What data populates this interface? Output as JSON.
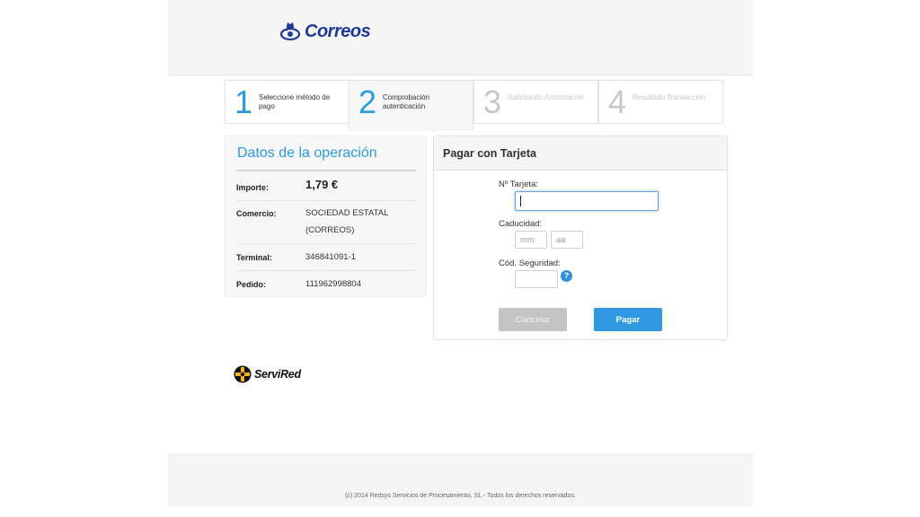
{
  "brand": {
    "name": "Correos",
    "color": "#1f3a93",
    "icon": "crown-horn-icon"
  },
  "steps": [
    {
      "number": "1",
      "label": "Seleccione método de pago",
      "state": "done"
    },
    {
      "number": "2",
      "label": "Comprobación autenticación",
      "state": "active"
    },
    {
      "number": "3",
      "label": "Solicitando Autorización",
      "state": "pending"
    },
    {
      "number": "4",
      "label": "Resultado Transacción",
      "state": "pending"
    }
  ],
  "operation": {
    "title": "Datos de la operación",
    "rows": [
      {
        "key": "Importe:",
        "value": "1,79 €"
      },
      {
        "key": "Comercio:",
        "value": "SOCIEDAD ESTATAL (CORREOS)"
      },
      {
        "key": "Terminal:",
        "value": "346841091-1"
      },
      {
        "key": "Pedido:",
        "value": "111962998804"
      }
    ]
  },
  "payment": {
    "title": "Pagar con Tarjeta",
    "card_label": "Nº Tarjeta:",
    "card_value": "",
    "expiry_label": "Caducidad:",
    "month_placeholder": "mm",
    "year_placeholder": "aa",
    "cvv_label": "Cód. Seguridad:",
    "cvv_value": "",
    "help_glyph": "?",
    "cancel_label": "Cancelar",
    "submit_label": "Pagar"
  },
  "network": {
    "name": "ServiRed",
    "icon": "servired-logo-icon"
  },
  "footer": {
    "text": "(c) 2014 Redsys Servicios de Procesamiento, SL - Todos los derechos reservados."
  },
  "colors": {
    "accent": "#2f9ad8",
    "button_primary": "#2f9ae0",
    "button_disabled": "#c4c4c4"
  }
}
